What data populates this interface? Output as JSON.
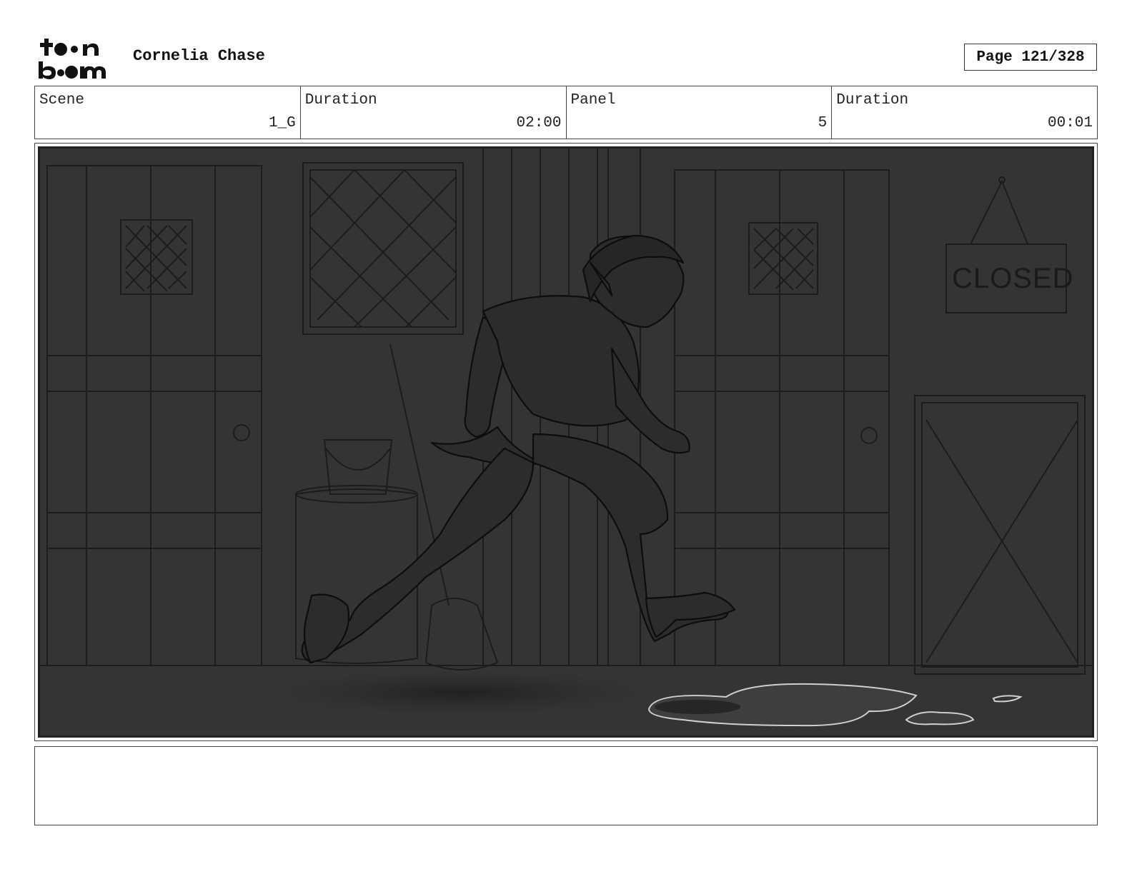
{
  "header": {
    "logo_text": "toonboom",
    "project_title": "Cornelia Chase",
    "page_label": "Page 121/328"
  },
  "info": {
    "scene_label": "Scene",
    "scene_value": "1_G",
    "scene_duration_label": "Duration",
    "scene_duration_value": "02:00",
    "panel_label": "Panel",
    "panel_value": "5",
    "panel_duration_label": "Duration",
    "panel_duration_value": "00:01"
  },
  "panel": {
    "sign_text": "CLOSED"
  },
  "notes": {
    "text": ""
  }
}
